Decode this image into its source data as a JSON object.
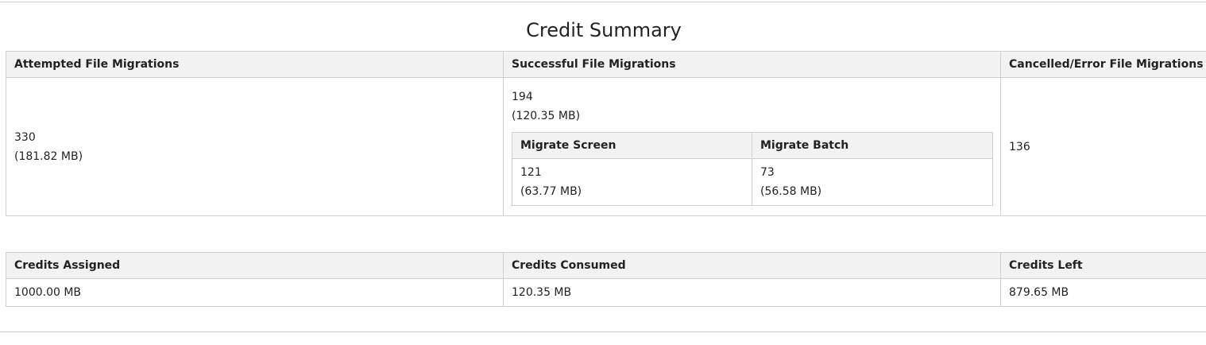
{
  "title": "Credit Summary",
  "migrations": {
    "headers": [
      "Attempted File Migrations",
      "Successful File Migrations",
      "Cancelled/Error File Migrations"
    ],
    "attempted": {
      "count": "330",
      "size": "(181.82 MB)"
    },
    "successful": {
      "count": "194",
      "size": "(120.35 MB)"
    },
    "breakdown": {
      "headers": [
        "Migrate Screen",
        "Migrate Batch"
      ],
      "screen": {
        "count": "121",
        "size": "(63.77 MB)"
      },
      "batch": {
        "count": "73",
        "size": "(56.58 MB)"
      }
    },
    "cancelled": {
      "count": "136"
    }
  },
  "credits": {
    "headers": [
      "Credits Assigned",
      "Credits Consumed",
      "Credits Left"
    ],
    "values": [
      "1000.00 MB",
      "120.35 MB",
      "879.65 MB"
    ]
  }
}
